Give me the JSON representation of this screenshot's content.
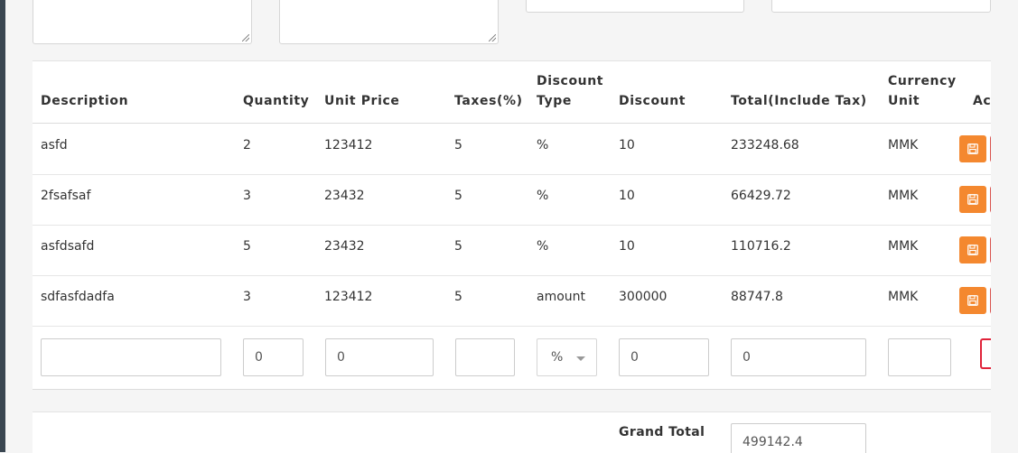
{
  "table": {
    "headers": {
      "description": "Description",
      "quantity": "Quantity",
      "unit_price": "Unit Price",
      "taxes": "Taxes(%)",
      "discount_type_1": "Discount",
      "discount_type_2": "Type",
      "discount": "Discount",
      "total": "Total(Include Tax)",
      "currency_1": "Currency",
      "currency_2": "Unit",
      "action": "Action"
    },
    "rows": [
      {
        "description": "asfd",
        "quantity": "2",
        "unit_price": "123412",
        "taxes": "5",
        "discount_type": "%",
        "discount": "10",
        "total": "233248.68",
        "currency": "MMK"
      },
      {
        "description": "2fsafsaf",
        "quantity": "3",
        "unit_price": "23432",
        "taxes": "5",
        "discount_type": "%",
        "discount": "10",
        "total": "66429.72",
        "currency": "MMK"
      },
      {
        "description": "asfdsafd",
        "quantity": "5",
        "unit_price": "23432",
        "taxes": "5",
        "discount_type": "%",
        "discount": "10",
        "total": "110716.2",
        "currency": "MMK"
      },
      {
        "description": "sdfasfdadfa",
        "quantity": "3",
        "unit_price": "123412",
        "taxes": "5",
        "discount_type": "amount",
        "discount": "300000",
        "total": "88747.8",
        "currency": "MMK"
      }
    ],
    "new_row": {
      "description": "",
      "quantity": "0",
      "unit_price": "0",
      "taxes": "",
      "discount_type": "%",
      "discount": "0",
      "total": "0",
      "currency": ""
    }
  },
  "footer": {
    "grand_total_label": "Grand Total",
    "grand_total_value": "499142.4"
  },
  "colors": {
    "save_button": "#f4882f",
    "delete_button": "#e0233a",
    "sidebar": "#3a4651"
  },
  "icons": {
    "save": "floppy-disk-icon"
  }
}
